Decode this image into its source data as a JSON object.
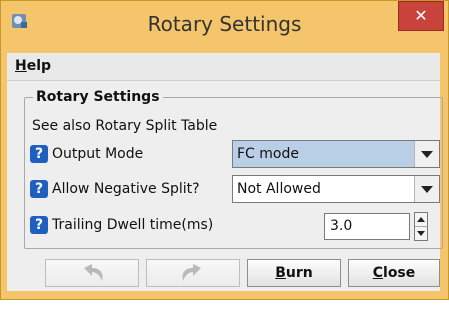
{
  "window": {
    "title": "Rotary Settings",
    "close_glyph": "✕"
  },
  "menu": {
    "help_mnemonic": "H",
    "help_rest": "elp"
  },
  "panel": {
    "legend": "Rotary Settings",
    "see_also": "See also Rotary Split Table",
    "help_glyph": "?",
    "rows": [
      {
        "label": "Output Mode",
        "value": "FC mode"
      },
      {
        "label": "Allow Negative Split?",
        "value": "Not Allowed"
      },
      {
        "label": "Trailing Dwell time(ms)",
        "value": "3.0"
      }
    ]
  },
  "buttons": {
    "undo_icon": "undo-icon",
    "redo_icon": "redo-icon",
    "burn_mnemonic": "B",
    "burn_rest": "urn",
    "close_mnemonic": "C",
    "close_rest": "lose"
  },
  "colors": {
    "title_bar": "#f4c56a",
    "close_button": "#c7433b",
    "help_icon": "#1f5fbf",
    "selected_combo": "#b8cfe5"
  }
}
